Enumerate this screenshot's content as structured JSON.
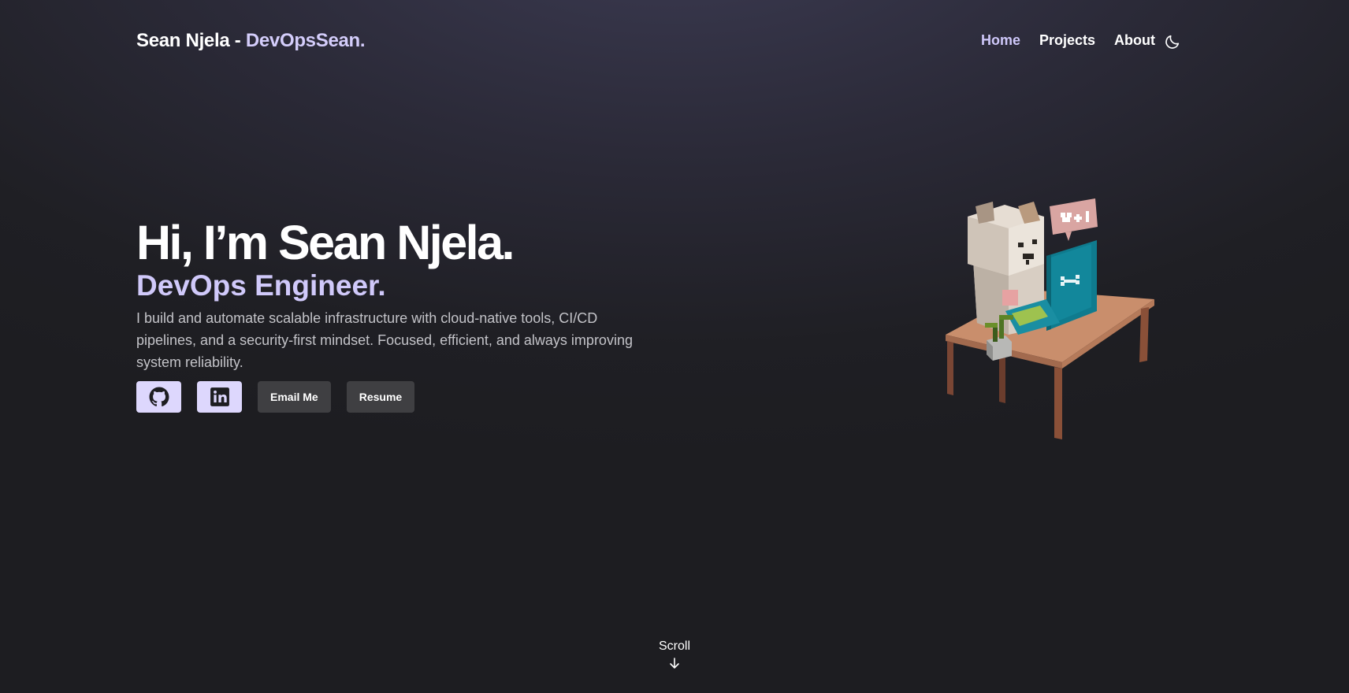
{
  "nav": {
    "brand_main": "Sean Njela - ",
    "brand_accent": "DevOpsSean.",
    "links": [
      "Home",
      "Projects",
      "About"
    ],
    "active_link": "Home",
    "theme_toggle_icon": "moon-icon"
  },
  "hero": {
    "greeting": "Hi, I’m Sean Njela.",
    "role": "DevOps Engineer.",
    "description": "I build and automate scalable infrastructure with cloud-native tools, CI/CD pipelines, and a security-first mindset. Focused, efficient, and always improving system reliability.",
    "buttons": {
      "github_icon": "github-icon",
      "linkedin_icon": "linkedin-icon",
      "email_label": "Email Me",
      "resume_label": "Resume"
    },
    "illustration": "voxel-dog-at-desk-with-laptop"
  },
  "scroll": {
    "label": "Scroll",
    "icon": "arrow-down-icon"
  },
  "colors": {
    "accent": "#d4cdfb",
    "button_dark": "#3f3f42",
    "background_dark": "#1d1d21"
  }
}
